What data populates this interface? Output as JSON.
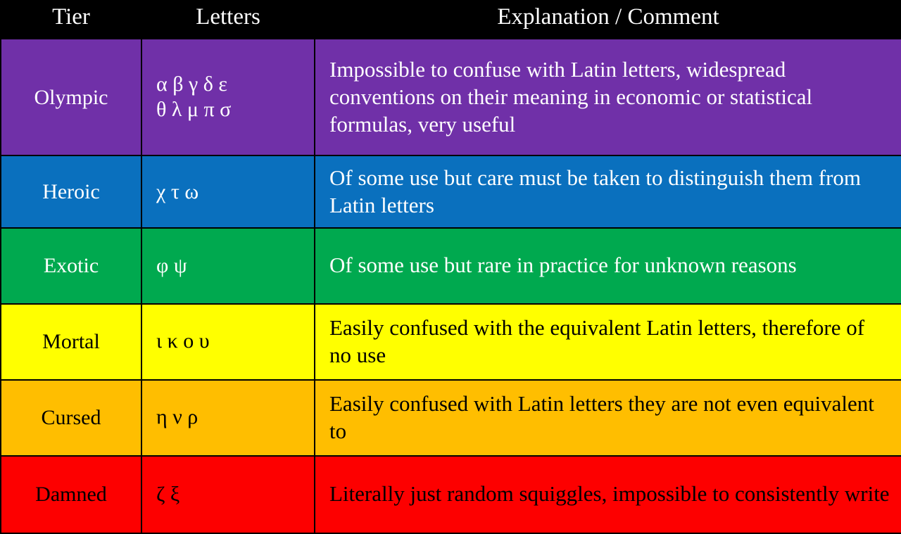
{
  "table": {
    "headers": {
      "tier": "Tier",
      "letters": "Letters",
      "explanation": "Explanation / Comment"
    },
    "rows": [
      {
        "tier": "Olympic",
        "letters": "α  β  γ  δ  ε\nθ  λ  μ  π  σ",
        "explanation": "Impossible to confuse with Latin letters, widespread conventions on their meaning in economic or statistical formulas, very useful",
        "color": "#7030a8",
        "text_color": "#ffffff"
      },
      {
        "tier": "Heroic",
        "letters": "χ  τ  ω",
        "explanation": "Of some use but care must be taken to distinguish them from Latin letters",
        "color": "#0a70be",
        "text_color": "#ffffff"
      },
      {
        "tier": "Exotic",
        "letters": "φ  ψ",
        "explanation": "Of some use but rare in practice for unknown reasons",
        "color": "#00a94f",
        "text_color": "#ffffff"
      },
      {
        "tier": "Mortal",
        "letters": "ι  κ  ο  υ",
        "explanation": "Easily confused with the equivalent Latin letters, therefore of no use",
        "color": "#ffff00",
        "text_color": "#000000"
      },
      {
        "tier": "Cursed",
        "letters": "η  ν  ρ",
        "explanation": "Easily confused with Latin letters they are not even equivalent to",
        "color": "#ffbe00",
        "text_color": "#000000"
      },
      {
        "tier": "Damned",
        "letters": "ζ  ξ",
        "explanation": "Literally just random squiggles, impossible to consistently write",
        "color": "#fd0000",
        "text_color": "#000000"
      }
    ]
  }
}
